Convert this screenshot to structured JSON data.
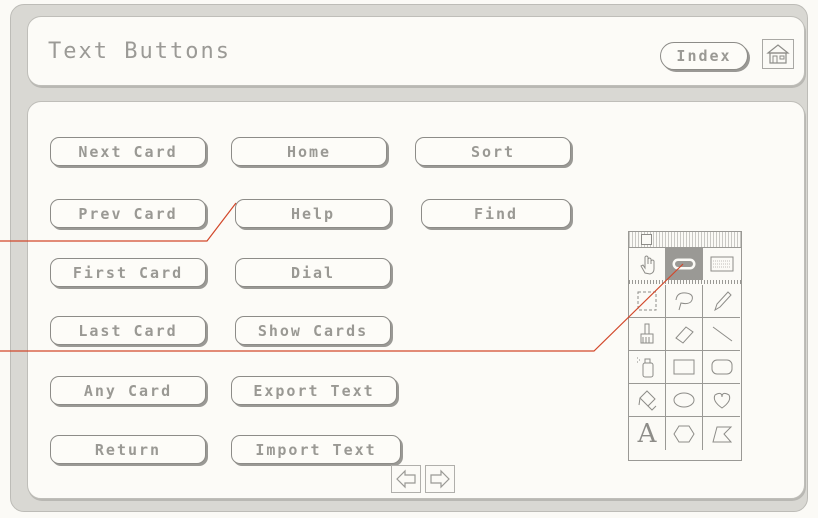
{
  "header": {
    "title": "Text Buttons",
    "index_label": "Index",
    "home_icon": "home-icon"
  },
  "buttons": {
    "col1": [
      "Next Card",
      "Prev Card",
      "First Card",
      "Last Card",
      "Any Card",
      "Return"
    ],
    "col2": [
      "Home",
      "Help",
      "Dial",
      "Show Cards",
      "Export Text",
      "Import Text"
    ],
    "col3": [
      "Sort",
      "Find"
    ]
  },
  "nav": {
    "prev_icon": "left-arrow-icon",
    "next_icon": "right-arrow-icon"
  },
  "tools_palette": {
    "tools": [
      "browse-tool",
      "button-tool",
      "field-tool",
      "select-tool",
      "lasso-tool",
      "pencil-tool",
      "brush-tool",
      "eraser-tool",
      "line-tool",
      "spray-tool",
      "rectangle-tool",
      "round-rectangle-tool",
      "bucket-tool",
      "oval-tool",
      "curve-tool",
      "text-tool",
      "regular-polygon-tool",
      "polygon-tool"
    ],
    "selected": "button-tool",
    "text_tool_glyph": "A"
  },
  "colors": {
    "callout_line": "#d2482b",
    "background": "#d9d8d3",
    "text": "#9a9994"
  }
}
